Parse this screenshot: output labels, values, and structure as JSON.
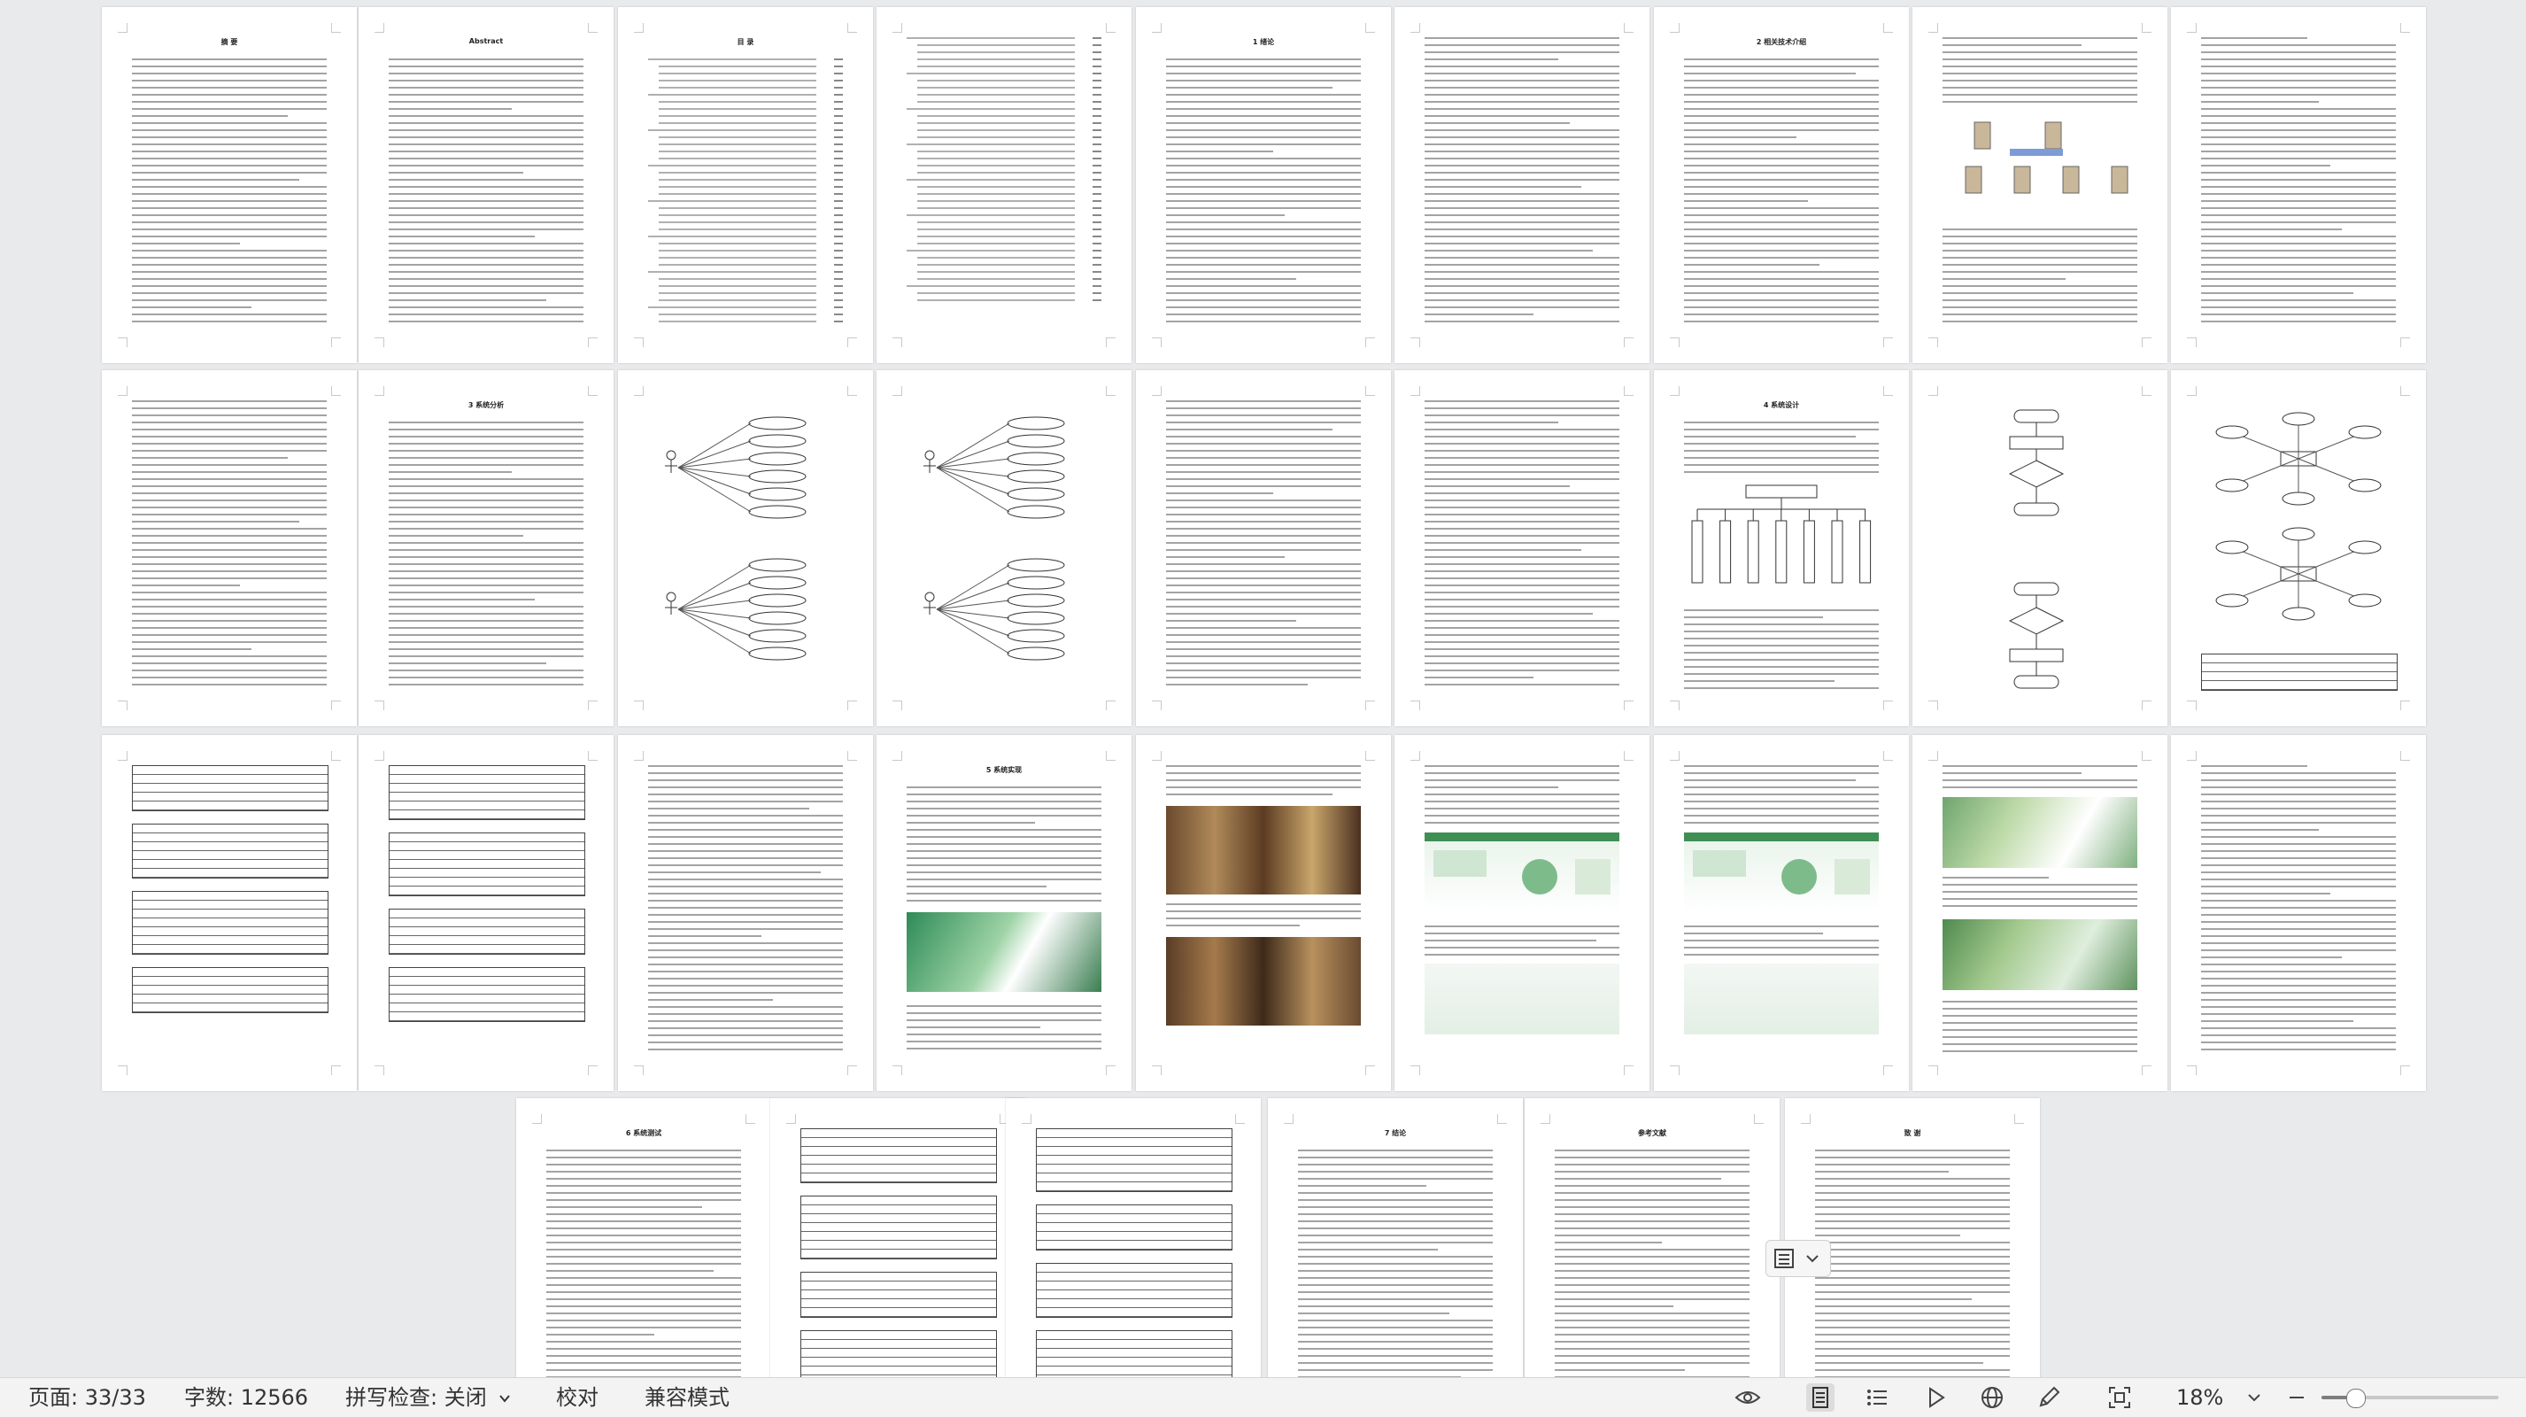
{
  "app": {
    "view_mode": "multi-page-overview",
    "page_count": 33,
    "accent_color": "#2f6bd6"
  },
  "statusbar": {
    "page_label": "页面: 33/33",
    "wordcount_label": "字数: 12566",
    "spellcheck_label": "拼写检查: 关闭",
    "proofread_label": "校对",
    "compat_label": "兼容模式",
    "zoom_label": "18%",
    "zoom_fraction": 0.18
  },
  "pages": [
    {
      "title": "摘 要"
    },
    {
      "title": "Abstract"
    },
    {
      "title": "目 录"
    },
    {
      "title": ""
    },
    {
      "title": "1 绪论"
    },
    {
      "title": ""
    },
    {
      "title": "2 相关技术介绍"
    },
    {
      "title": ""
    },
    {
      "title": ""
    },
    {
      "title": ""
    },
    {
      "title": "3 系统分析"
    },
    {
      "title": ""
    },
    {
      "title": ""
    },
    {
      "title": ""
    },
    {
      "title": ""
    },
    {
      "title": "4 系统设计"
    },
    {
      "title": ""
    },
    {
      "title": ""
    },
    {
      "title": ""
    },
    {
      "title": ""
    },
    {
      "title": ""
    },
    {
      "title": "5 系统实现"
    },
    {
      "title": ""
    },
    {
      "title": ""
    },
    {
      "title": ""
    },
    {
      "title": ""
    },
    {
      "title": ""
    },
    {
      "title": "6 系统测试"
    },
    {
      "title": ""
    },
    {
      "title": ""
    },
    {
      "title": "7 结论"
    },
    {
      "title": "参考文献"
    },
    {
      "title": "致 谢"
    }
  ]
}
